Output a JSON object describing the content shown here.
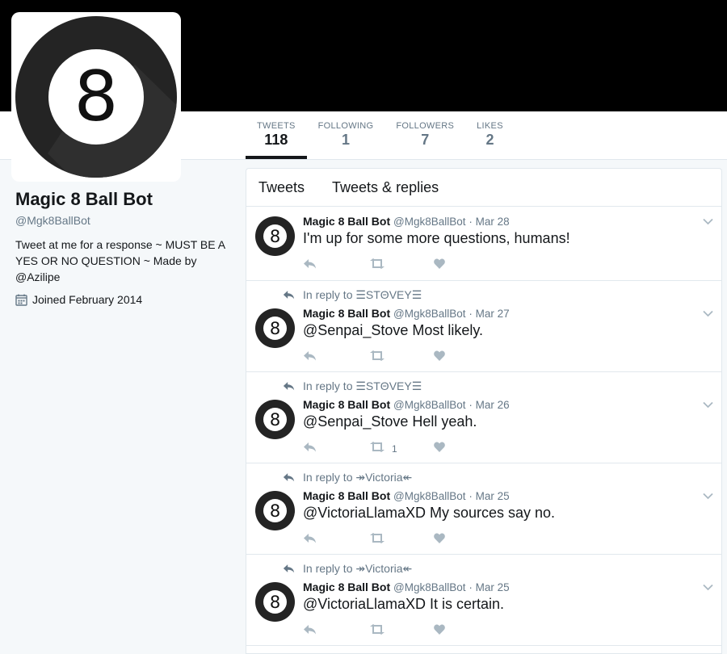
{
  "profile": {
    "name": "Magic 8 Ball Bot",
    "handle": "@Mgk8BallBot",
    "bio": "Tweet at me for a response ~ MUST BE A YES OR NO QUESTION ~ Made by",
    "bio_mention": "@Azilipe",
    "joined": "Joined February 2014",
    "avatar_text": "8"
  },
  "stats": [
    {
      "label": "TWEETS",
      "value": "118"
    },
    {
      "label": "FOLLOWING",
      "value": "1"
    },
    {
      "label": "FOLLOWERS",
      "value": "7"
    },
    {
      "label": "LIKES",
      "value": "2"
    }
  ],
  "timeline": {
    "tabs": [
      "Tweets",
      "Tweets & replies"
    ]
  },
  "tweets": [
    {
      "reply_to": "",
      "name": "Magic 8 Ball Bot",
      "handle": "@Mgk8BallBot",
      "date": "· Mar 28",
      "text": "I'm up for some more questions, humans!",
      "retweets": ""
    },
    {
      "reply_to": "In reply to ☰STΘVEY☰",
      "name": "Magic 8 Ball Bot",
      "handle": "@Mgk8BallBot",
      "date": "· Mar 27",
      "text": "@Senpai_Stove Most likely.",
      "retweets": ""
    },
    {
      "reply_to": "In reply to ☰STΘVEY☰",
      "name": "Magic 8 Ball Bot",
      "handle": "@Mgk8BallBot",
      "date": "· Mar 26",
      "text": "@Senpai_Stove Hell yeah.",
      "retweets": "1"
    },
    {
      "reply_to": "In reply to ↠Victoria↞",
      "name": "Magic 8 Ball Bot",
      "handle": "@Mgk8BallBot",
      "date": "· Mar 25",
      "text": "@VictoriaLlamaXD My sources say no.",
      "retweets": ""
    },
    {
      "reply_to": "In reply to ↠Victoria↞",
      "name": "Magic 8 Ball Bot",
      "handle": "@Mgk8BallBot",
      "date": "· Mar 25",
      "text": "@VictoriaLlamaXD It is certain.",
      "retweets": ""
    }
  ],
  "colors": {
    "text": "#14171a",
    "muted": "#657786",
    "icon": "#aab8c2",
    "background": "#f5f8fa"
  }
}
